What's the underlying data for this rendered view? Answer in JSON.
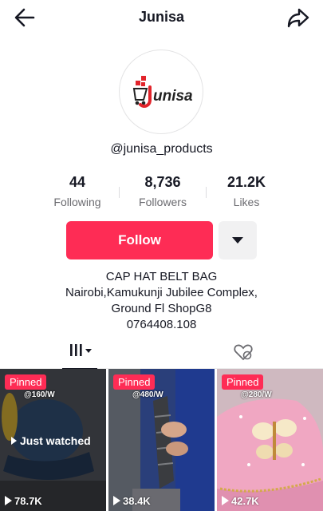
{
  "header": {
    "title": "Junisa",
    "back_icon": "arrow-left-icon",
    "share_icon": "share-arrow-icon"
  },
  "profile": {
    "logo_text": "unisa",
    "username": "@junisa_products"
  },
  "stats": {
    "following": {
      "value": "44",
      "label": "Following"
    },
    "followers": {
      "value": "8,736",
      "label": "Followers"
    },
    "likes": {
      "value": "21.2K",
      "label": "Likes"
    }
  },
  "actions": {
    "follow_label": "Follow",
    "more_icon": "caret-down-icon",
    "follow_color": "#fe2c55"
  },
  "bio": {
    "line1": "CAP HAT BELT BAG",
    "line2": "Nairobi,Kamukunji Jubilee Complex,",
    "line3": "Ground Fl ShopG8",
    "line4": "0764408.108"
  },
  "tabs": {
    "videos_icon": "grid-icon",
    "liked_icon": "heart-hidden-icon"
  },
  "videos": [
    {
      "pinned": "Pinned",
      "price": "@160/W",
      "views": "78.7K",
      "overlay": "Just watched"
    },
    {
      "pinned": "Pinned",
      "price": "@480/W",
      "views": "38.4K"
    },
    {
      "pinned": "Pinned",
      "price": "@280/W",
      "views": "42.7K"
    }
  ]
}
